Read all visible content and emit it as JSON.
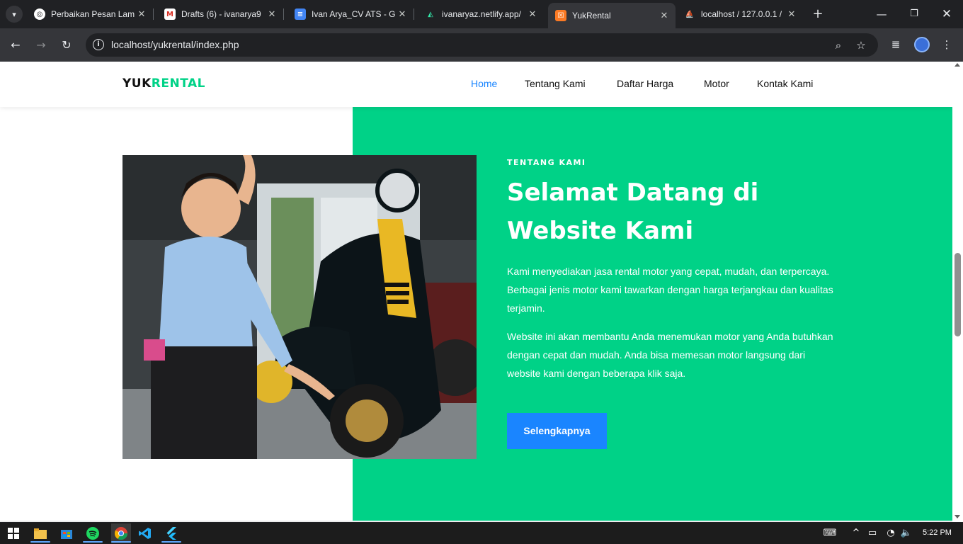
{
  "browser": {
    "tabs": [
      {
        "title": "Perbaikan Pesan Lam",
        "favicon": "chatgpt-icon",
        "active": false
      },
      {
        "title": "Drafts (6) - ivanarya9",
        "favicon": "gmail-icon",
        "active": false
      },
      {
        "title": "Ivan Arya_CV ATS - G",
        "favicon": "google-docs-icon",
        "active": false
      },
      {
        "title": "ivanaryaz.netlify.app/",
        "favicon": "netlify-icon",
        "active": false
      },
      {
        "title": "YukRental",
        "favicon": "xampp-icon",
        "active": true
      },
      {
        "title": "localhost / 127.0.0.1 /",
        "favicon": "phpmyadmin-icon",
        "active": false
      }
    ],
    "url": "localhost/yukrental/index.php"
  },
  "site": {
    "logo_part1": "YUK",
    "logo_part2": "RENTAL",
    "nav": [
      "Home",
      "Tentang Kami",
      "Daftar Harga",
      "Motor",
      "Kontak Kami"
    ],
    "active_nav": "Home"
  },
  "about": {
    "eyebrow": "TENTANG KAMI",
    "title": "Selamat Datang di Website Kami",
    "paragraph1": "Kami menyediakan jasa rental motor yang cepat, mudah, dan terpercaya. Berbagai jenis motor kami tawarkan dengan harga terjangkau dan kualitas terjamin.",
    "paragraph2": "Website ini akan membantu Anda menemukan motor yang Anda butuhkan dengan cepat dan mudah. Anda bisa memesan motor langsung dari website kami dengan beberapa klik saja.",
    "button": "Selengkapnya"
  },
  "taskbar": {
    "apps": [
      "windows-start-icon",
      "file-explorer-icon",
      "microsoft-store-icon",
      "spotify-icon",
      "chrome-icon",
      "vscode-icon",
      "flutter-icon"
    ],
    "time": "5:22 PM"
  },
  "colors": {
    "brand_green": "#00d287",
    "accent_blue": "#1a85ff",
    "browser_dark": "#202124"
  }
}
